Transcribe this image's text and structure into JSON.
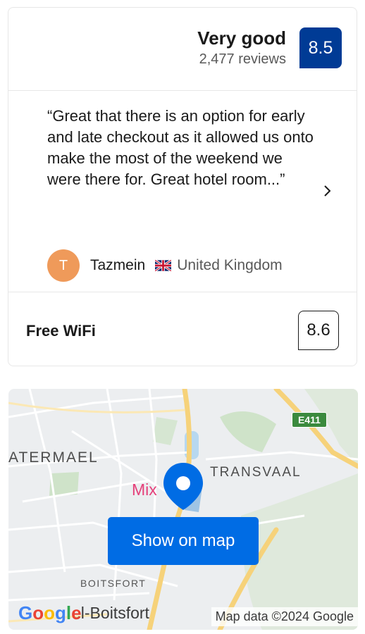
{
  "rating": {
    "word": "Very good",
    "reviews": "2,477 reviews",
    "score": "8.5"
  },
  "review": {
    "text": "“Great that there is an option for early and late checkout as it allowed us onto make the most of the weekend we were there for. Great hotel room...”",
    "avatar_initial": "T",
    "reviewer_name": "Tazmein",
    "reviewer_country": "United Kingdom"
  },
  "facility": {
    "label": "Free WiFi",
    "score": "8.6"
  },
  "map": {
    "button_label": "Show on map",
    "labels": {
      "watermael": "ATERMAEL",
      "transvaal": "TRANSVAAL",
      "mix": "Mix",
      "boitsfort": "BOITSFORT",
      "mel_boitsfort": "el-Boitsfort",
      "road_shield": "E411"
    },
    "attribution": "Map data ©2024 Google"
  },
  "colors": {
    "brand_blue": "#003b95",
    "button_blue": "#006ce4",
    "avatar": "#ef9a5a"
  }
}
